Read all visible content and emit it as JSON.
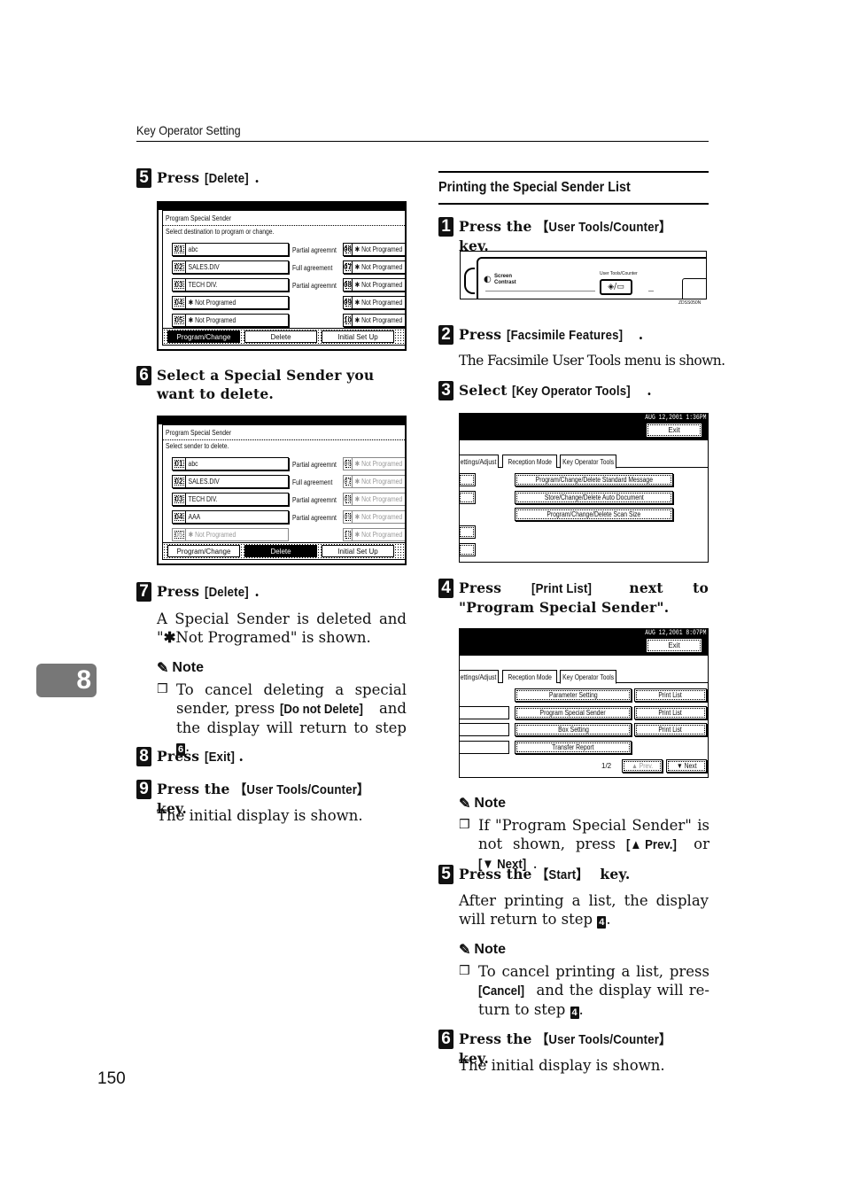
{
  "header": {
    "running_head": "Key Operator Setting"
  },
  "chapter_tab": "8",
  "page_number": "150",
  "left_column": {
    "step5": {
      "num": "5",
      "text": "Press ",
      "key": "[Delete]",
      "end": "."
    },
    "screen1": {
      "title": "Program Special Sender",
      "subtitle": "Select destination to program or change.",
      "entries_left": [
        {
          "no": "01",
          "name": "abc",
          "match": "Partial agreemnt"
        },
        {
          "no": "02",
          "name": "SALES.DIV",
          "match": "Full agreement"
        },
        {
          "no": "03",
          "name": "TECH DIV.",
          "match": "Partial agreemnt"
        },
        {
          "no": "04",
          "name": "✱ Not Programed",
          "match": ""
        },
        {
          "no": "05",
          "name": "✱ Not Programed",
          "match": ""
        }
      ],
      "entries_right": [
        {
          "no": "06",
          "name": "✱ Not Programed"
        },
        {
          "no": "07",
          "name": "✱ Not Programed"
        },
        {
          "no": "08",
          "name": "✱ Not Programed"
        },
        {
          "no": "09",
          "name": "✱ Not Programed"
        },
        {
          "no": "10",
          "name": "✱ Not Programed"
        }
      ],
      "buttons": [
        "Program/Change",
        "Delete",
        "Initial Set Up"
      ],
      "active_button": "Program/Change"
    },
    "step6": {
      "num": "6",
      "text": "Select a Special Sender you want to delete."
    },
    "screen2": {
      "title": "Program Special Sender",
      "subtitle": "Select sender to delete.",
      "entries_left": [
        {
          "no": "01",
          "name": "abc",
          "match": "Partial agreemnt"
        },
        {
          "no": "02",
          "name": "SALES.DIV",
          "match": "Full agreement"
        },
        {
          "no": "03",
          "name": "TECH DIV.",
          "match": "Partial agreemnt"
        },
        {
          "no": "04",
          "name": "AAA",
          "match": "Partial agreemnt"
        },
        {
          "no": "05",
          "name": "✱ Not Programed",
          "match": ""
        }
      ],
      "entries_right": [
        {
          "no": "06",
          "name": "✱ Not Programed"
        },
        {
          "no": "07",
          "name": "✱ Not Programed"
        },
        {
          "no": "08",
          "name": "✱ Not Programed"
        },
        {
          "no": "09",
          "name": "✱ Not Programed"
        },
        {
          "no": "10",
          "name": "✱ Not Programed"
        }
      ],
      "buttons": [
        "Program/Change",
        "Delete",
        "Initial Set Up"
      ],
      "active_button": "Delete"
    },
    "step7": {
      "num": "7",
      "text": "Press ",
      "key": "[Delete]",
      "end": ".",
      "body_a": "A Special Sender is deleted and \"",
      "body_star": "✱",
      "body_b": "Not Programed\" is shown.",
      "note_label": "Note",
      "note_a": "To cancel deleting a special sender, press ",
      "note_key": "[Do not Delete]",
      "note_b": " and the display will return to step ",
      "note_step": "6",
      "note_end": "."
    },
    "step8": {
      "num": "8",
      "text": "Press ",
      "key": "[Exit]",
      "end": "."
    },
    "step9": {
      "num": "9",
      "text": "Press the ",
      "key": "【User Tools/Counter】",
      "end": " key.",
      "body": "The initial display is shown."
    }
  },
  "right_column": {
    "section_title": "Printing the Special Sender List",
    "step1": {
      "num": "1",
      "text": "Press the ",
      "key": "【User Tools/Counter】",
      "end": " key."
    },
    "panel": {
      "screen_contrast_1": "Screen",
      "screen_contrast_2": "Contrast",
      "user_tools_label": "User Tools/Counter",
      "code": "ZDSS050N"
    },
    "step2": {
      "num": "2",
      "text": "Press ",
      "key": "[Facsimile Features]",
      "end": ".",
      "body": "The Facsimile User Tools menu is shown."
    },
    "step3": {
      "num": "3",
      "text": "Select ",
      "key": "[Key Operator Tools]",
      "end": "."
    },
    "screen3": {
      "date": "AUG  12,2001  1:36PM",
      "exit": "Exit",
      "tabs": [
        "ettings/Adjust",
        "Reception Mode",
        "Key Operator Tools"
      ],
      "buttons": [
        "Program/Change/Delete Standard Message",
        "Store/Change/Delete Auto Document",
        "Program/Change/Delete Scan Size"
      ]
    },
    "step4": {
      "num": "4",
      "text": "Press ",
      "key": "[Print List]",
      "end": " next to \"Program Special Sender\"."
    },
    "screen4": {
      "date": "AUG  12,2001  8:07PM",
      "exit": "Exit",
      "tabs": [
        "ettings/Adjust",
        "Reception Mode",
        "Key Operator Tools"
      ],
      "rows": [
        {
          "label": "Parameter Setting",
          "print": "Print List"
        },
        {
          "label": "Program Special Sender",
          "print": "Print List"
        },
        {
          "label": "Box Setting",
          "print": "Print List"
        },
        {
          "label": "Transfer Report",
          "print": ""
        }
      ],
      "page": "1/2",
      "prev": "▲ Prev.",
      "next": "▼ Next"
    },
    "note1": {
      "label": "Note",
      "a": "If \"Program Special Sender\" is not shown, press ",
      "key1": "[▲ Prev.]",
      "mid": " or ",
      "key2": "[▼ Next]",
      "end": "."
    },
    "step5": {
      "num": "5",
      "text": "Press the ",
      "key": "【Start】",
      "end": " key.",
      "body_a": "After printing a list, the display will return to step ",
      "body_step": "4",
      "body_end": "."
    },
    "note2": {
      "label": "Note",
      "a": "To cancel printing a list, press ",
      "key": "[Cancel]",
      "b": " and the display will re-turn to step ",
      "step": "4",
      "end": "."
    },
    "step6": {
      "num": "6",
      "text": "Press the ",
      "key": "【User Tools/Counter】",
      "end": " key.",
      "body": "The initial display is shown."
    }
  }
}
